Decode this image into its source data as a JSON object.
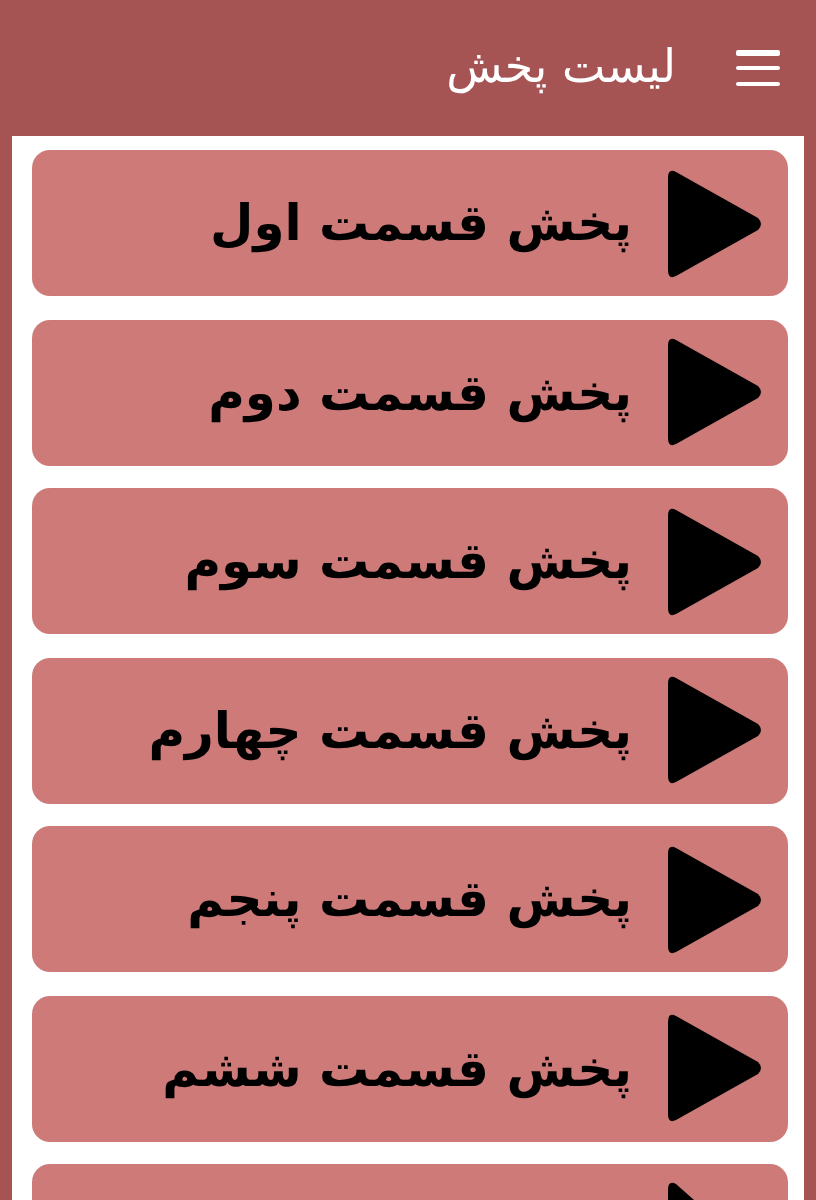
{
  "app_bar": {
    "title": "لیست پخش"
  },
  "episodes": [
    {
      "label": "پخش قسمت اول"
    },
    {
      "label": "پخش قسمت دوم"
    },
    {
      "label": "پخش قسمت سوم"
    },
    {
      "label": "پخش قسمت چهارم"
    },
    {
      "label": "پخش قسمت پنجم"
    },
    {
      "label": "پخش قسمت ششم"
    },
    {
      "kind": "cut"
    }
  ]
}
